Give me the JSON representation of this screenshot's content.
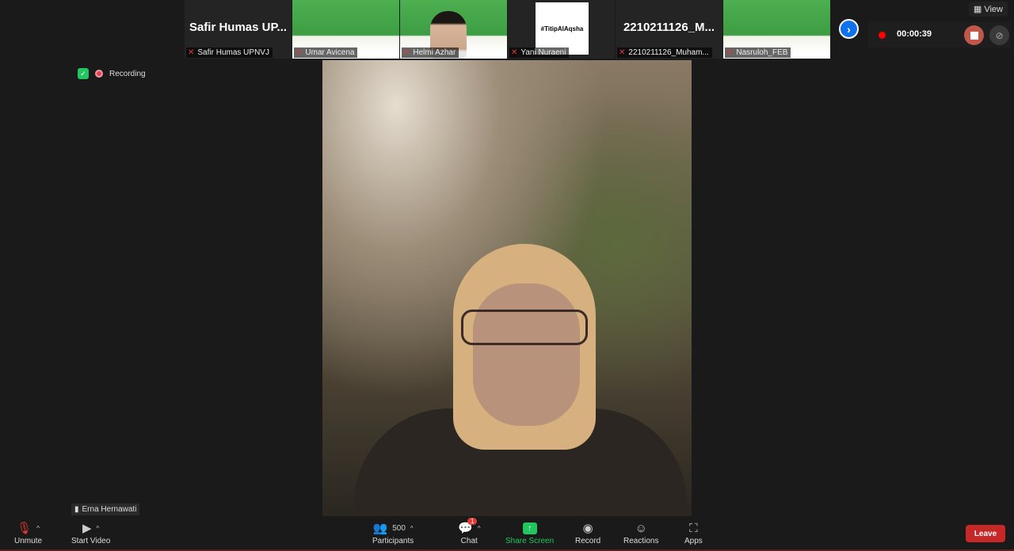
{
  "gallery": [
    {
      "display": "Safir Humas UP...",
      "name": "Safir Humas UPNVJ",
      "type": "text"
    },
    {
      "name": "Umar Avicena",
      "type": "slide"
    },
    {
      "name": "Helmi Azhar",
      "type": "camera"
    },
    {
      "display": "#TitipAlAqsha",
      "name": "Yani Nuraeni",
      "type": "image"
    },
    {
      "display": "2210211126_M...",
      "name": "2210211126_Muham...",
      "type": "text"
    },
    {
      "name": "Nasruloh_FEB",
      "type": "slide"
    }
  ],
  "view_label": "View",
  "recording": {
    "timer": "00:00:39",
    "status_label": "Recording"
  },
  "speaker_name": "Erna Hernawati",
  "toolbar": {
    "unmute": "Unmute",
    "start_video": "Start Video",
    "participants": "Participants",
    "participant_count": "500",
    "chat": "Chat",
    "chat_badge": "1",
    "share_screen": "Share Screen",
    "record": "Record",
    "reactions": "Reactions",
    "apps": "Apps",
    "leave": "Leave"
  },
  "colors": {
    "accent_blue": "#0e72ed",
    "share_green": "#22c55e",
    "leave_red": "#c62828"
  }
}
